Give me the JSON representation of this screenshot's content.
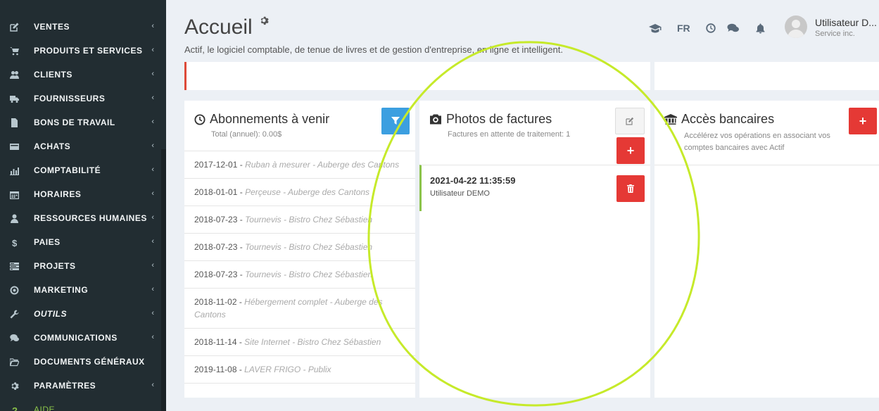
{
  "sidebar": {
    "items": [
      {
        "label": "VENTES",
        "icon": "edit-icon",
        "chevron": "‹"
      },
      {
        "label": "PRODUITS ET SERVICES",
        "icon": "cart-icon",
        "chevron": "‹"
      },
      {
        "label": "CLIENTS",
        "icon": "users-icon",
        "chevron": "‹"
      },
      {
        "label": "FOURNISSEURS",
        "icon": "truck-icon",
        "chevron": "‹"
      },
      {
        "label": "BONS DE TRAVAIL",
        "icon": "file-icon",
        "chevron": "‹"
      },
      {
        "label": "ACHATS",
        "icon": "credit-card-icon",
        "chevron": "‹"
      },
      {
        "label": "COMPTABILITÉ",
        "icon": "bar-chart-icon",
        "chevron": "‹"
      },
      {
        "label": "HORAIRES",
        "icon": "calendar-icon",
        "chevron": "‹"
      },
      {
        "label": "RESSOURCES HUMAINES",
        "icon": "user-icon",
        "chevron": "‹"
      },
      {
        "label": "PAIES",
        "icon": "dollar-icon",
        "chevron": "‹"
      },
      {
        "label": "PROJETS",
        "icon": "tasks-icon",
        "chevron": "‹"
      },
      {
        "label": "MARKETING",
        "icon": "bullseye-icon",
        "chevron": "‹"
      },
      {
        "label": "OUTILS",
        "icon": "wrench-icon",
        "chevron": "‹"
      },
      {
        "label": "COMMUNICATIONS",
        "icon": "comments-icon",
        "chevron": "‹"
      },
      {
        "label": "DOCUMENTS GÉNÉRAUX",
        "icon": "folder-open-icon",
        "chevron": ""
      },
      {
        "label": "PARAMÈTRES",
        "icon": "gear-icon",
        "chevron": "‹"
      },
      {
        "label": "AIDE",
        "icon": "question-icon",
        "chevron": ""
      }
    ]
  },
  "header": {
    "title": "Accueil",
    "subtitle": "Actif, le logiciel comptable, de tenue de livres et de gestion d'entreprise, en ligne et intelligent.",
    "lang": "FR",
    "user_name": "Utilisateur D...",
    "user_company": "Service inc."
  },
  "subscriptions": {
    "title": "Abonnements à venir",
    "total": "Total (annuel): 0.00$",
    "rows": [
      {
        "date": "2017-12-01",
        "sep": " - ",
        "desc": "Ruban à mesurer - Auberge des Cantons"
      },
      {
        "date": "2018-01-01",
        "sep": " - ",
        "desc": "Perçeuse - Auberge des Cantons"
      },
      {
        "date": "2018-07-23",
        "sep": " - ",
        "desc": "Tournevis - Bistro Chez Sébastien"
      },
      {
        "date": "2018-07-23",
        "sep": " - ",
        "desc": "Tournevis - Bistro Chez Sébastien"
      },
      {
        "date": "2018-07-23",
        "sep": " - ",
        "desc": "Tournevis - Bistro Chez Sébastien"
      },
      {
        "date": "2018-11-02",
        "sep": " - ",
        "desc": "Hébergement complet - Auberge des Cantons"
      },
      {
        "date": "2018-11-14",
        "sep": " - ",
        "desc": "Site Internet - Bistro Chez Sébastien"
      },
      {
        "date": "2019-11-08",
        "sep": " - ",
        "desc": "LAVER FRIGO - Publix"
      }
    ]
  },
  "photos": {
    "title": "Photos de factures",
    "pending": "Factures en attente de traitement: 1",
    "entry_date": "2021-04-22 11:35:59",
    "entry_user": "Utilisateur DEMO"
  },
  "bank": {
    "title": "Accès bancaires",
    "desc": "Accélérez vos opérations en associant vos comptes bancaires avec Actif"
  },
  "colors": {
    "sidebar_bg": "#222d32",
    "content_bg": "#ecf0f5",
    "red": "#e53935",
    "blue": "#3c9fe0",
    "green_accent": "#8bc34a",
    "annotation": "#c6ea2a"
  }
}
